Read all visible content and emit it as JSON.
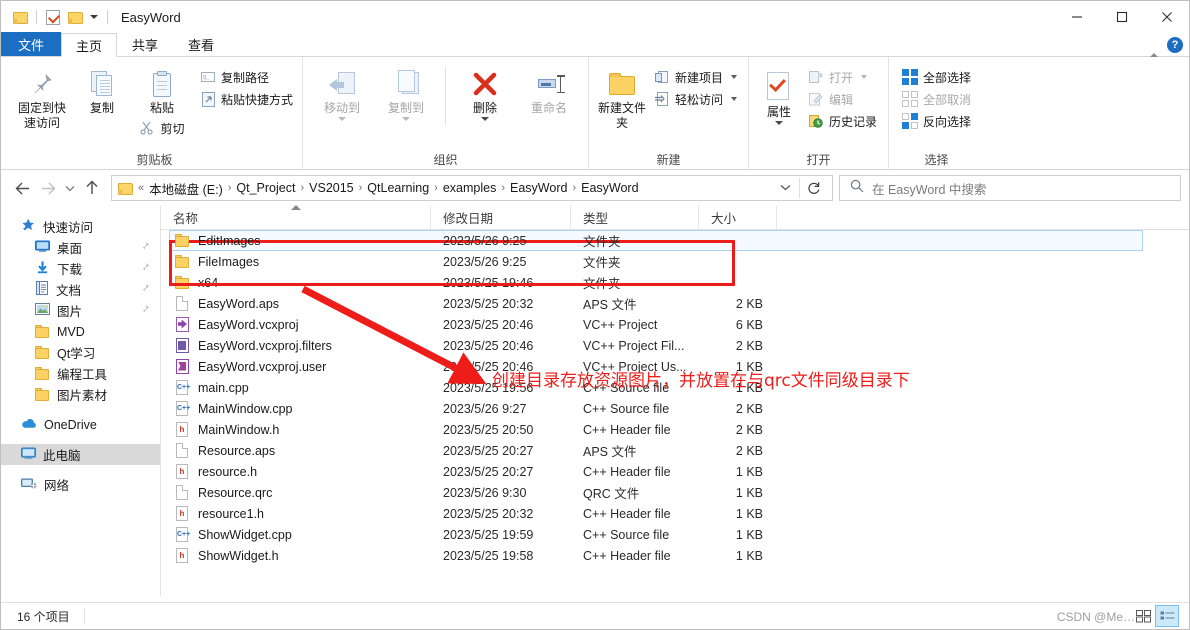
{
  "window": {
    "title": "EasyWord",
    "quick_access": [
      "folder-icon",
      "checkbox-icon",
      "folder-icon"
    ],
    "minimize": "—",
    "maximize": "□",
    "close": "✕"
  },
  "tabs": [
    {
      "label": "文件",
      "id": "file"
    },
    {
      "label": "主页",
      "id": "home"
    },
    {
      "label": "共享",
      "id": "share"
    },
    {
      "label": "查看",
      "id": "view"
    }
  ],
  "tab_right": {
    "collapse": "chevron-up-icon",
    "help": "?"
  },
  "ribbon": {
    "groups": [
      {
        "label": "剪贴板",
        "big": [
          {
            "label": "固定到快速访问",
            "icon": "pin-icon",
            "disabled": false
          },
          {
            "label": "复制",
            "icon": "copy-icon",
            "disabled": false
          },
          {
            "label": "粘贴",
            "icon": "paste-icon",
            "disabled": false
          }
        ],
        "small": [
          {
            "label": "复制路径",
            "icon": "copy-path-icon"
          },
          {
            "label": "粘贴快捷方式",
            "icon": "paste-shortcut-icon"
          }
        ],
        "paste_sub": {
          "label": "剪切",
          "icon": "scissors-icon"
        }
      },
      {
        "label": "组织",
        "big": [
          {
            "label": "移动到",
            "icon": "move-to-icon",
            "disabled": true,
            "caret": true
          },
          {
            "label": "复制到",
            "icon": "copy-to-icon",
            "disabled": true,
            "caret": true
          },
          {
            "label": "删除",
            "icon": "delete-icon",
            "disabled": false,
            "caret": true
          },
          {
            "label": "重命名",
            "icon": "rename-icon",
            "disabled": true
          }
        ]
      },
      {
        "label": "新建",
        "big": [
          {
            "label": "新建文件夹",
            "icon": "new-folder-icon",
            "disabled": false
          }
        ],
        "small": [
          {
            "label": "新建项目",
            "icon": "new-item-icon",
            "caret": true
          },
          {
            "label": "轻松访问",
            "icon": "easy-access-icon",
            "caret": true
          }
        ]
      },
      {
        "label": "打开",
        "big": [
          {
            "label": "属性",
            "icon": "properties-icon",
            "disabled": false,
            "caret": true
          }
        ],
        "small": [
          {
            "label": "打开",
            "icon": "open-icon",
            "caret": true,
            "disabled": true
          },
          {
            "label": "编辑",
            "icon": "edit-icon",
            "disabled": true
          },
          {
            "label": "历史记录",
            "icon": "history-icon",
            "disabled": false
          }
        ]
      },
      {
        "label": "选择",
        "small": [
          {
            "label": "全部选择",
            "icon": "select-all-icon"
          },
          {
            "label": "全部取消",
            "icon": "select-none-icon",
            "disabled": true
          },
          {
            "label": "反向选择",
            "icon": "invert-selection-icon"
          }
        ]
      }
    ]
  },
  "addressbar": {
    "back": "back-icon",
    "forward": "forward-icon",
    "recent": "recent-locations-icon",
    "up": "up-icon",
    "crumbs": [
      "本地磁盘 (E:)",
      "Qt_Project",
      "VS2015",
      "QtLearning",
      "examples",
      "EasyWord",
      "EasyWord"
    ],
    "prefix": "«",
    "dropdown": "chevron-down-icon",
    "refresh": "refresh-icon",
    "search_placeholder": "在 EasyWord 中搜索",
    "search_icon": "search-icon"
  },
  "navpane": {
    "items": [
      {
        "label": "快速访问",
        "icon": "quick-access-star-icon",
        "level": 0,
        "pinned": false,
        "selected": false
      },
      {
        "label": "桌面",
        "icon": "desktop-icon",
        "level": 1,
        "pinned": true,
        "selected": false
      },
      {
        "label": "下载",
        "icon": "downloads-icon",
        "level": 1,
        "pinned": true,
        "selected": false
      },
      {
        "label": "文档",
        "icon": "documents-icon",
        "level": 1,
        "pinned": true,
        "selected": false
      },
      {
        "label": "图片",
        "icon": "pictures-icon",
        "level": 1,
        "pinned": true,
        "selected": false
      },
      {
        "label": "MVD",
        "icon": "folder-icon",
        "level": 1,
        "pinned": false,
        "selected": false
      },
      {
        "label": "Qt学习",
        "icon": "folder-icon",
        "level": 1,
        "pinned": false,
        "selected": false
      },
      {
        "label": "编程工具",
        "icon": "folder-icon",
        "level": 1,
        "pinned": false,
        "selected": false
      },
      {
        "label": "图片素材",
        "icon": "folder-icon",
        "level": 1,
        "pinned": false,
        "selected": false
      },
      {
        "label": "OneDrive",
        "icon": "onedrive-icon",
        "level": 0,
        "pinned": false,
        "selected": false,
        "gap_before": true
      },
      {
        "label": "此电脑",
        "icon": "this-pc-icon",
        "level": 0,
        "pinned": false,
        "selected": true,
        "gap_before": true
      },
      {
        "label": "网络",
        "icon": "network-icon",
        "level": 0,
        "pinned": false,
        "selected": false,
        "gap_before": true
      }
    ]
  },
  "filelist": {
    "columns": [
      {
        "label": "名称",
        "key": "name",
        "sorted": true
      },
      {
        "label": "修改日期",
        "key": "date"
      },
      {
        "label": "类型",
        "key": "type"
      },
      {
        "label": "大小",
        "key": "size"
      }
    ],
    "rows": [
      {
        "name": "EditImages",
        "date": "2023/5/26 9:25",
        "type": "文件夹",
        "size": "",
        "icon": "folder-icon",
        "selected": true
      },
      {
        "name": "FileImages",
        "date": "2023/5/26 9:25",
        "type": "文件夹",
        "size": "",
        "icon": "folder-icon",
        "selected": false
      },
      {
        "name": "x64",
        "date": "2023/5/25 19:46",
        "type": "文件夹",
        "size": "",
        "icon": "folder-icon",
        "selected": false
      },
      {
        "name": "EasyWord.aps",
        "date": "2023/5/25 20:32",
        "type": "APS 文件",
        "size": "2 KB",
        "icon": "generic-file-icon",
        "selected": false
      },
      {
        "name": "EasyWord.vcxproj",
        "date": "2023/5/25 20:46",
        "type": "VC++ Project",
        "size": "6 KB",
        "icon": "vcxproj-icon",
        "selected": false
      },
      {
        "name": "EasyWord.vcxproj.filters",
        "date": "2023/5/25 20:46",
        "type": "VC++ Project Fil...",
        "size": "2 KB",
        "icon": "vcxproj-filters-icon",
        "selected": false
      },
      {
        "name": "EasyWord.vcxproj.user",
        "date": "2023/5/25 20:46",
        "type": "VC++ Project Us...",
        "size": "1 KB",
        "icon": "vcxproj-user-icon",
        "selected": false
      },
      {
        "name": "main.cpp",
        "date": "2023/5/25 19:56",
        "type": "C++ Source file",
        "size": "1 KB",
        "icon": "cpp-file-icon",
        "selected": false
      },
      {
        "name": "MainWindow.cpp",
        "date": "2023/5/26 9:27",
        "type": "C++ Source file",
        "size": "2 KB",
        "icon": "cpp-file-icon",
        "selected": false
      },
      {
        "name": "MainWindow.h",
        "date": "2023/5/25 20:50",
        "type": "C++ Header file",
        "size": "2 KB",
        "icon": "h-file-icon",
        "selected": false
      },
      {
        "name": "Resource.aps",
        "date": "2023/5/25 20:27",
        "type": "APS 文件",
        "size": "2 KB",
        "icon": "generic-file-icon",
        "selected": false
      },
      {
        "name": "resource.h",
        "date": "2023/5/25 20:27",
        "type": "C++ Header file",
        "size": "1 KB",
        "icon": "h-file-icon",
        "selected": false
      },
      {
        "name": "Resource.qrc",
        "date": "2023/5/26 9:30",
        "type": "QRC 文件",
        "size": "1 KB",
        "icon": "generic-file-icon",
        "selected": false
      },
      {
        "name": "resource1.h",
        "date": "2023/5/25 20:32",
        "type": "C++ Header file",
        "size": "1 KB",
        "icon": "h-file-icon",
        "selected": false
      },
      {
        "name": "ShowWidget.cpp",
        "date": "2023/5/25 19:59",
        "type": "C++ Source file",
        "size": "1 KB",
        "icon": "cpp-file-icon",
        "selected": false
      },
      {
        "name": "ShowWidget.h",
        "date": "2023/5/25 19:58",
        "type": "C++ Header file",
        "size": "1 KB",
        "icon": "h-file-icon",
        "selected": false
      }
    ]
  },
  "annotations": {
    "color": "#ec1c18",
    "highlight_rows": [
      0,
      1
    ],
    "text": "创建目录存放资源图片，并放置在与qrc文件同级目录下"
  },
  "statusbar": {
    "count": "16 个项目",
    "watermark": "CSDN @Me…",
    "views": [
      {
        "name": "large-icons-view",
        "active": false
      },
      {
        "name": "details-view",
        "active": true
      }
    ]
  }
}
